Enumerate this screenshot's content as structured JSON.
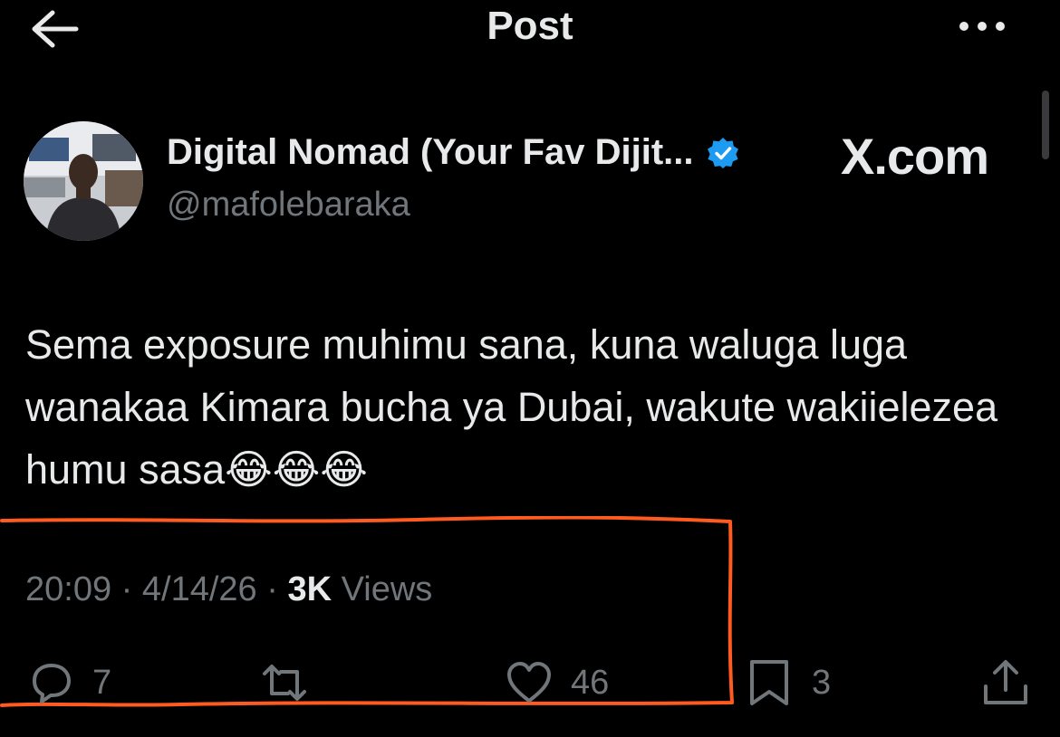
{
  "header": {
    "title": "Post"
  },
  "author": {
    "name": "Digital Nomad (Your Fav Dijit...",
    "handle": "@mafolebaraka"
  },
  "watermark": "X.com",
  "post": {
    "text": "Sema exposure muhimu sana, kuna waluga luga wanakaa Kimara bucha ya Dubai, wakute wakiielezea humu sasa😂😂😂"
  },
  "meta": {
    "time": "20:09",
    "date": "4/14/26",
    "views_count": "3K",
    "views_label": "Views"
  },
  "actions": {
    "reply_count": "7",
    "like_count": "46",
    "bookmark_count": "3"
  },
  "colors": {
    "background": "#000000",
    "text_primary": "#e7e9ea",
    "text_secondary": "#71767b",
    "verified_badge": "#1d9bf0",
    "annotation": "#ff5a1f"
  },
  "icons": [
    "back-arrow-icon",
    "more-icon",
    "verified-badge-icon",
    "reply-icon",
    "repost-icon",
    "like-icon",
    "bookmark-icon",
    "share-icon"
  ]
}
